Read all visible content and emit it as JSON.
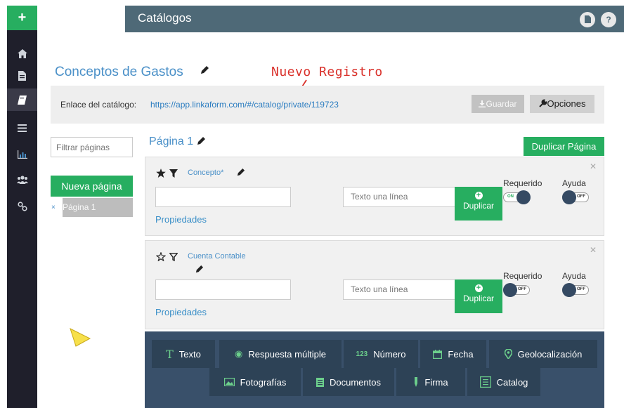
{
  "sidebar": {
    "add_label": "+",
    "items": [
      {
        "name": "home",
        "icon": "home-icon"
      },
      {
        "name": "forms",
        "icon": "file-icon"
      },
      {
        "name": "catalogs",
        "icon": "book-icon",
        "active": true
      },
      {
        "name": "records",
        "icon": "list-icon"
      },
      {
        "name": "reports",
        "icon": "bar-chart-icon"
      },
      {
        "name": "users",
        "icon": "users-icon"
      },
      {
        "name": "connections",
        "icon": "link-icon"
      }
    ]
  },
  "topbar": {
    "title": "Catálogos",
    "doc_icon": "document-icon",
    "help_label": "?"
  },
  "catalog": {
    "title": "Conceptos de Gastos",
    "annotation": "Nuevo Registro",
    "link_label": "Enlace del catálogo:",
    "link_url": "https://app.linkaform.com/#/catalog/private/119723",
    "save_label": "Guardar",
    "options_label": "Opciones"
  },
  "pages_panel": {
    "filter_placeholder": "Filtrar páginas",
    "new_page_label": "Nueva página",
    "page_remove": "×",
    "page_name": "Página 1"
  },
  "page": {
    "title": "Página 1",
    "duplicate_page_label": "Duplicar Página"
  },
  "fields": [
    {
      "label": "Concepto*",
      "type_value": "Texto una línea",
      "properties_label": "Propiedades",
      "duplicate_label": "Duplicar",
      "required_label": "Requerido",
      "required_state": "ON",
      "help_label": "Ayuda",
      "help_state": "OFF",
      "star": "filled"
    },
    {
      "label": "Cuenta Contable",
      "type_value": "Texto una línea",
      "properties_label": "Propiedades",
      "duplicate_label": "Duplicar",
      "required_label": "Requerido",
      "required_state": "OFF",
      "help_label": "Ayuda",
      "help_state": "OFF",
      "star": "outline"
    }
  ],
  "palette": {
    "row1": [
      {
        "label": "Texto",
        "icon": "T"
      },
      {
        "label": "Respuesta múltiple",
        "icon": "◉"
      },
      {
        "label": "Número",
        "icon": "123"
      },
      {
        "label": "Fecha",
        "icon": "calendar-icon"
      },
      {
        "label": "Geolocalización",
        "icon": "map-pin-icon"
      }
    ],
    "row2": [
      {
        "label": "Fotografías",
        "icon": "image-icon"
      },
      {
        "label": "Documentos",
        "icon": "document-icon"
      },
      {
        "label": "Firma",
        "icon": "pen-icon"
      },
      {
        "label": "Catalog",
        "icon": "catalog-icon"
      }
    ]
  },
  "colors": {
    "accent": "#27ae60",
    "topbar": "#4e6977",
    "sidebar": "#1f1f2b",
    "link": "#4a90c8",
    "annotation": "#d9302a",
    "palette": "#39506a"
  }
}
